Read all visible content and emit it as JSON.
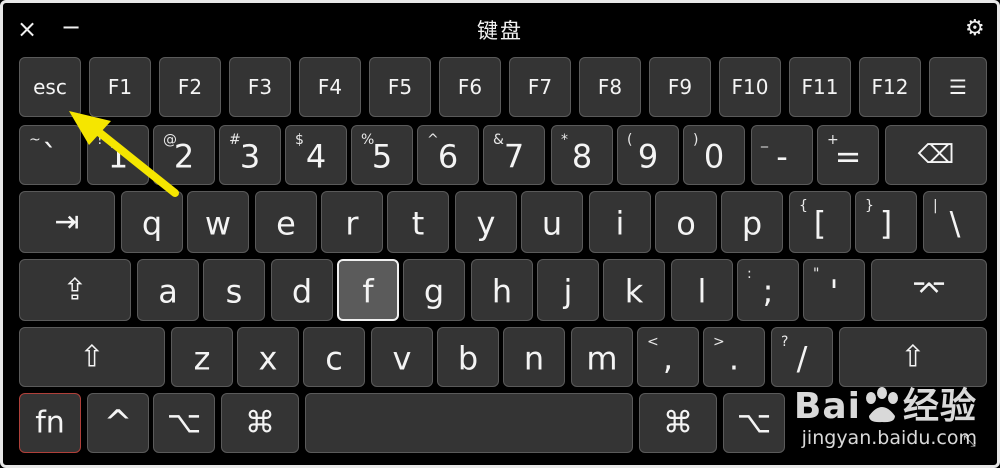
{
  "window": {
    "title": "键盘",
    "close_label": "×",
    "minimize_label": "−",
    "settings_label": "⚙"
  },
  "keys": {
    "esc": "esc",
    "f1": "F1",
    "f2": "F2",
    "f3": "F3",
    "f4": "F4",
    "f5": "F5",
    "f6": "F6",
    "f7": "F7",
    "f8": "F8",
    "f9": "F9",
    "f10": "F10",
    "f11": "F11",
    "f12": "F12",
    "list": "☰",
    "backtick": {
      "main": "`",
      "sub": "~"
    },
    "d1": {
      "main": "1",
      "sub": "!"
    },
    "d2": {
      "main": "2",
      "sub": "@"
    },
    "d3": {
      "main": "3",
      "sub": "#"
    },
    "d4": {
      "main": "4",
      "sub": "$"
    },
    "d5": {
      "main": "5",
      "sub": "%"
    },
    "d6": {
      "main": "6",
      "sub": "^"
    },
    "d7": {
      "main": "7",
      "sub": "&"
    },
    "d8": {
      "main": "8",
      "sub": "*"
    },
    "d9": {
      "main": "9",
      "sub": "("
    },
    "d0": {
      "main": "0",
      "sub": ")"
    },
    "minus": {
      "main": "-",
      "sub": "_"
    },
    "equal": {
      "main": "=",
      "sub": "+"
    },
    "delete": "⌫",
    "tab": "⇥",
    "q": "q",
    "w": "w",
    "e": "e",
    "r": "r",
    "t": "t",
    "y": "y",
    "u": "u",
    "i": "i",
    "o": "o",
    "p": "p",
    "lbracket": {
      "main": "[",
      "sub": "{"
    },
    "rbracket": {
      "main": "]",
      "sub": "}"
    },
    "backslash": {
      "main": "\\",
      "sub": "|"
    },
    "capslock": "⇪",
    "a": "a",
    "s": "s",
    "d": "d",
    "f": "f",
    "g": "g",
    "h": "h",
    "j": "j",
    "k": "k",
    "l": "l",
    "semicolon": {
      "main": ";",
      "sub": ":"
    },
    "quote": {
      "main": "'",
      "sub": "\""
    },
    "enter": "⌤",
    "lshift": "⇧",
    "z": "z",
    "x": "x",
    "c": "c",
    "v": "v",
    "b": "b",
    "n": "n",
    "m": "m",
    "comma": {
      "main": ",",
      "sub": "<"
    },
    "period": {
      "main": ".",
      "sub": ">"
    },
    "slash": {
      "main": "/",
      "sub": "?"
    },
    "rshift": "⇧",
    "fn": "fn",
    "ctrl": "^",
    "lopt": "⌥",
    "lcmd": "⌘",
    "rcmd": "⌘",
    "ropt": "⌥",
    "resize": "⤡"
  },
  "watermark": {
    "brand": "Bai",
    "brand2": "经验",
    "url": "jingyan.baidu.com"
  },
  "annotation": {
    "color": "#f5e600"
  }
}
